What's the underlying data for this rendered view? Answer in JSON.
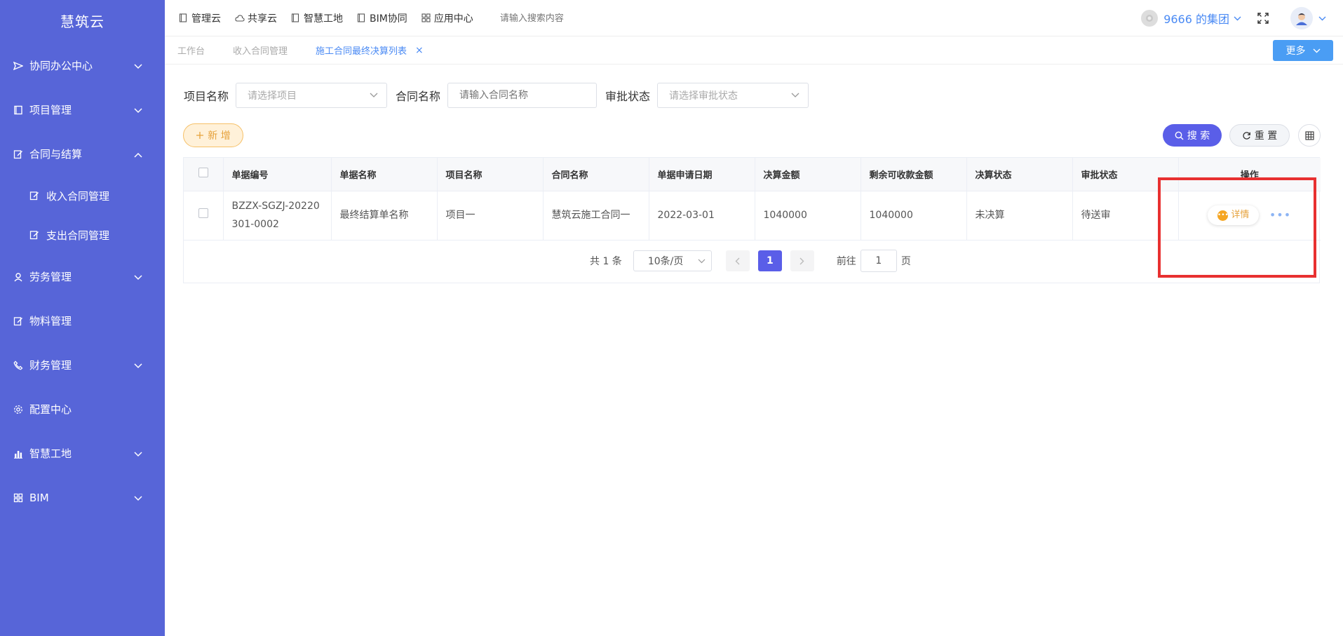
{
  "app": {
    "name": "慧筑云"
  },
  "sidebar": {
    "items": [
      {
        "label": "协同办公中心",
        "icon": "send-icon",
        "expandable": true
      },
      {
        "label": "项目管理",
        "icon": "book-icon",
        "expandable": true
      },
      {
        "label": "合同与结算",
        "icon": "edit-icon",
        "expandable": true,
        "expanded": true
      },
      {
        "label": "劳务管理",
        "icon": "people-icon",
        "expandable": true
      },
      {
        "label": "物料管理",
        "icon": "edit-icon",
        "expandable": false
      },
      {
        "label": "财务管理",
        "icon": "phone-icon",
        "expandable": true
      },
      {
        "label": "配置中心",
        "icon": "gear-icon",
        "expandable": false
      },
      {
        "label": "智慧工地",
        "icon": "bar-chart-icon",
        "expandable": true
      },
      {
        "label": "BIM",
        "icon": "grid-icon",
        "expandable": true
      }
    ],
    "subitems": [
      {
        "label": "收入合同管理"
      },
      {
        "label": "支出合同管理"
      }
    ]
  },
  "topnav": {
    "items": [
      {
        "label": "管理云",
        "icon": "doc-icon"
      },
      {
        "label": "共享云",
        "icon": "cloud-icon"
      },
      {
        "label": "智慧工地",
        "icon": "doc-icon"
      },
      {
        "label": "BIM协同",
        "icon": "doc-icon"
      },
      {
        "label": "应用中心",
        "icon": "grid-icon"
      }
    ],
    "search_placeholder": "请输入搜索内容",
    "group_label": "9666 的集团"
  },
  "tabs": {
    "items": [
      {
        "label": "工作台"
      },
      {
        "label": "收入合同管理"
      },
      {
        "label": "施工合同最终决算列表"
      }
    ],
    "close": "×",
    "more_label": "更多"
  },
  "filters": {
    "project_label": "项目名称",
    "project_placeholder": "请选择项目",
    "contract_label": "合同名称",
    "contract_placeholder": "请输入合同名称",
    "status_label": "审批状态",
    "status_placeholder": "请选择审批状态"
  },
  "actions": {
    "add_label": "新 增",
    "search_label": "搜 索",
    "reset_label": "重 置"
  },
  "table": {
    "headers": [
      "单据编号",
      "单据名称",
      "项目名称",
      "合同名称",
      "单据申请日期",
      "决算金额",
      "剩余可收款金额",
      "决算状态",
      "审批状态",
      "操作"
    ],
    "rows": [
      {
        "code": "BZZX-SGZJ-20220301-0002",
        "name": "最终结算单名称",
        "project": "项目一",
        "contract": "慧筑云施工合同一",
        "date": "2022-03-01",
        "amount": "1040000",
        "remaining": "1040000",
        "settle_status": "未决算",
        "approve_status": "待送审",
        "detail_label": "详情",
        "more": "•••"
      }
    ]
  },
  "pagination": {
    "total": "共 1 条",
    "page_size": "10条/页",
    "current": "1",
    "goto_label": "前往",
    "goto_value": "1",
    "page_suffix": "页"
  }
}
